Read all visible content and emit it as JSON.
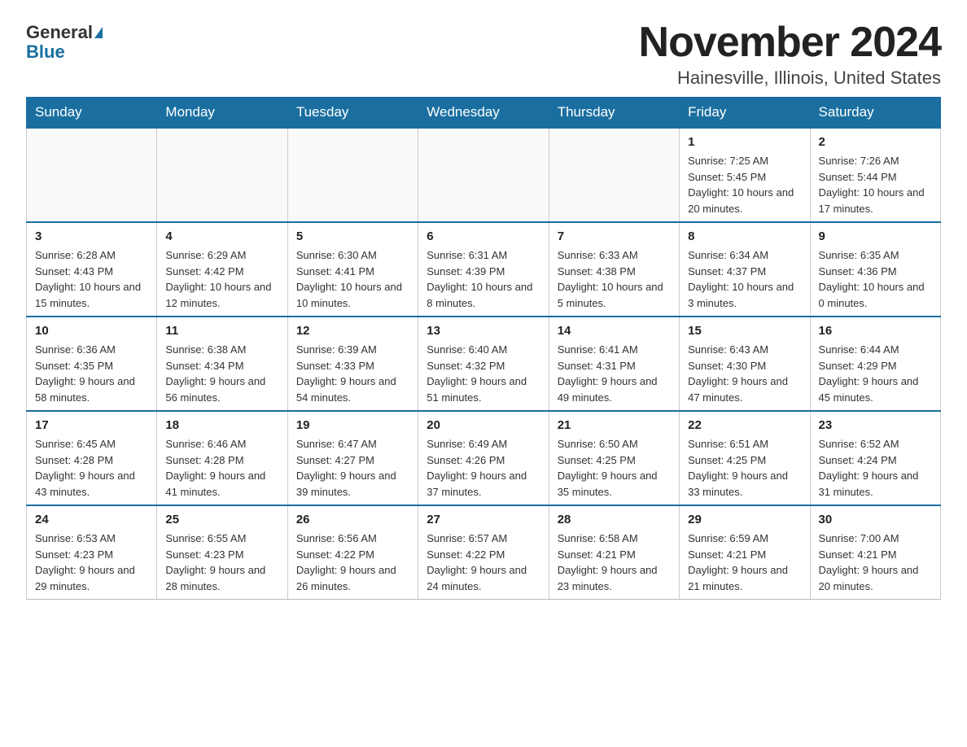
{
  "logo": {
    "general": "General",
    "blue": "Blue"
  },
  "title": "November 2024",
  "subtitle": "Hainesville, Illinois, United States",
  "weekdays": [
    "Sunday",
    "Monday",
    "Tuesday",
    "Wednesday",
    "Thursday",
    "Friday",
    "Saturday"
  ],
  "weeks": [
    [
      {
        "day": "",
        "info": ""
      },
      {
        "day": "",
        "info": ""
      },
      {
        "day": "",
        "info": ""
      },
      {
        "day": "",
        "info": ""
      },
      {
        "day": "",
        "info": ""
      },
      {
        "day": "1",
        "info": "Sunrise: 7:25 AM\nSunset: 5:45 PM\nDaylight: 10 hours and 20 minutes."
      },
      {
        "day": "2",
        "info": "Sunrise: 7:26 AM\nSunset: 5:44 PM\nDaylight: 10 hours and 17 minutes."
      }
    ],
    [
      {
        "day": "3",
        "info": "Sunrise: 6:28 AM\nSunset: 4:43 PM\nDaylight: 10 hours and 15 minutes."
      },
      {
        "day": "4",
        "info": "Sunrise: 6:29 AM\nSunset: 4:42 PM\nDaylight: 10 hours and 12 minutes."
      },
      {
        "day": "5",
        "info": "Sunrise: 6:30 AM\nSunset: 4:41 PM\nDaylight: 10 hours and 10 minutes."
      },
      {
        "day": "6",
        "info": "Sunrise: 6:31 AM\nSunset: 4:39 PM\nDaylight: 10 hours and 8 minutes."
      },
      {
        "day": "7",
        "info": "Sunrise: 6:33 AM\nSunset: 4:38 PM\nDaylight: 10 hours and 5 minutes."
      },
      {
        "day": "8",
        "info": "Sunrise: 6:34 AM\nSunset: 4:37 PM\nDaylight: 10 hours and 3 minutes."
      },
      {
        "day": "9",
        "info": "Sunrise: 6:35 AM\nSunset: 4:36 PM\nDaylight: 10 hours and 0 minutes."
      }
    ],
    [
      {
        "day": "10",
        "info": "Sunrise: 6:36 AM\nSunset: 4:35 PM\nDaylight: 9 hours and 58 minutes."
      },
      {
        "day": "11",
        "info": "Sunrise: 6:38 AM\nSunset: 4:34 PM\nDaylight: 9 hours and 56 minutes."
      },
      {
        "day": "12",
        "info": "Sunrise: 6:39 AM\nSunset: 4:33 PM\nDaylight: 9 hours and 54 minutes."
      },
      {
        "day": "13",
        "info": "Sunrise: 6:40 AM\nSunset: 4:32 PM\nDaylight: 9 hours and 51 minutes."
      },
      {
        "day": "14",
        "info": "Sunrise: 6:41 AM\nSunset: 4:31 PM\nDaylight: 9 hours and 49 minutes."
      },
      {
        "day": "15",
        "info": "Sunrise: 6:43 AM\nSunset: 4:30 PM\nDaylight: 9 hours and 47 minutes."
      },
      {
        "day": "16",
        "info": "Sunrise: 6:44 AM\nSunset: 4:29 PM\nDaylight: 9 hours and 45 minutes."
      }
    ],
    [
      {
        "day": "17",
        "info": "Sunrise: 6:45 AM\nSunset: 4:28 PM\nDaylight: 9 hours and 43 minutes."
      },
      {
        "day": "18",
        "info": "Sunrise: 6:46 AM\nSunset: 4:28 PM\nDaylight: 9 hours and 41 minutes."
      },
      {
        "day": "19",
        "info": "Sunrise: 6:47 AM\nSunset: 4:27 PM\nDaylight: 9 hours and 39 minutes."
      },
      {
        "day": "20",
        "info": "Sunrise: 6:49 AM\nSunset: 4:26 PM\nDaylight: 9 hours and 37 minutes."
      },
      {
        "day": "21",
        "info": "Sunrise: 6:50 AM\nSunset: 4:25 PM\nDaylight: 9 hours and 35 minutes."
      },
      {
        "day": "22",
        "info": "Sunrise: 6:51 AM\nSunset: 4:25 PM\nDaylight: 9 hours and 33 minutes."
      },
      {
        "day": "23",
        "info": "Sunrise: 6:52 AM\nSunset: 4:24 PM\nDaylight: 9 hours and 31 minutes."
      }
    ],
    [
      {
        "day": "24",
        "info": "Sunrise: 6:53 AM\nSunset: 4:23 PM\nDaylight: 9 hours and 29 minutes."
      },
      {
        "day": "25",
        "info": "Sunrise: 6:55 AM\nSunset: 4:23 PM\nDaylight: 9 hours and 28 minutes."
      },
      {
        "day": "26",
        "info": "Sunrise: 6:56 AM\nSunset: 4:22 PM\nDaylight: 9 hours and 26 minutes."
      },
      {
        "day": "27",
        "info": "Sunrise: 6:57 AM\nSunset: 4:22 PM\nDaylight: 9 hours and 24 minutes."
      },
      {
        "day": "28",
        "info": "Sunrise: 6:58 AM\nSunset: 4:21 PM\nDaylight: 9 hours and 23 minutes."
      },
      {
        "day": "29",
        "info": "Sunrise: 6:59 AM\nSunset: 4:21 PM\nDaylight: 9 hours and 21 minutes."
      },
      {
        "day": "30",
        "info": "Sunrise: 7:00 AM\nSunset: 4:21 PM\nDaylight: 9 hours and 20 minutes."
      }
    ]
  ]
}
